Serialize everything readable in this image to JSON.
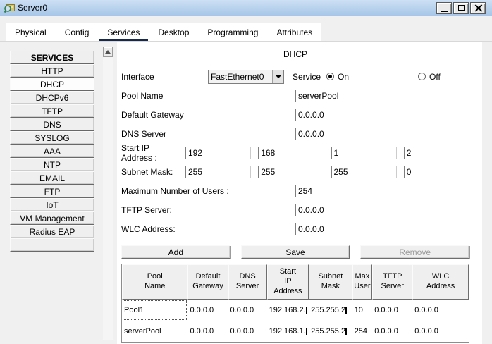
{
  "window": {
    "title": "Server0"
  },
  "tabs": [
    {
      "label": "Physical",
      "selected": false
    },
    {
      "label": "Config",
      "selected": false
    },
    {
      "label": "Services",
      "selected": true
    },
    {
      "label": "Desktop",
      "selected": false
    },
    {
      "label": "Programming",
      "selected": false
    },
    {
      "label": "Attributes",
      "selected": false
    }
  ],
  "sidebar": {
    "header": "SERVICES",
    "items": [
      {
        "label": "HTTP",
        "selected": false
      },
      {
        "label": "DHCP",
        "selected": true
      },
      {
        "label": "DHCPv6",
        "selected": false
      },
      {
        "label": "TFTP",
        "selected": false
      },
      {
        "label": "DNS",
        "selected": false
      },
      {
        "label": "SYSLOG",
        "selected": false
      },
      {
        "label": "AAA",
        "selected": false
      },
      {
        "label": "NTP",
        "selected": false
      },
      {
        "label": "EMAIL",
        "selected": false
      },
      {
        "label": "FTP",
        "selected": false
      },
      {
        "label": "IoT",
        "selected": false
      },
      {
        "label": "VM Management",
        "selected": false
      },
      {
        "label": "Radius EAP",
        "selected": false
      }
    ]
  },
  "dhcp": {
    "panel_title": "DHCP",
    "interface": {
      "label": "Interface",
      "value": "FastEthernet0"
    },
    "service": {
      "label": "Service",
      "on_label": "On",
      "off_label": "Off",
      "state": "On"
    },
    "fields_top": [
      {
        "label": "Pool Name",
        "value": "serverPool"
      },
      {
        "label": "Default Gateway",
        "value": "0.0.0.0"
      },
      {
        "label": "DNS Server",
        "value": "0.0.0.0"
      }
    ],
    "start_ip": {
      "label": "Start IP Address :",
      "octets": [
        "192",
        "168",
        "1",
        "2"
      ]
    },
    "subnet_mask": {
      "label": "Subnet Mask:",
      "octets": [
        "255",
        "255",
        "255",
        "0"
      ]
    },
    "fields_bottom": [
      {
        "label": "Maximum Number of Users :",
        "value": "254"
      },
      {
        "label": "TFTP Server:",
        "value": "0.0.0.0"
      },
      {
        "label": "WLC Address:",
        "value": "0.0.0.0"
      }
    ],
    "actions": [
      {
        "label": "Add",
        "enabled": true
      },
      {
        "label": "Save",
        "enabled": true
      },
      {
        "label": "Remove",
        "enabled": false
      }
    ],
    "table": {
      "headers": [
        "Pool\nName",
        "Default\nGateway",
        "DNS\nServer",
        "Start\nIP\nAddress",
        "Subnet\nMask",
        "Max\nUser",
        "TFTP\nServer",
        "WLC\nAddress"
      ],
      "rows": [
        {
          "cells": [
            "Pool1",
            "0.0.0.0",
            "0.0.0.0",
            "192.168.2.",
            "255.255.2",
            "10",
            "0.0.0.0",
            "0.0.0.0"
          ],
          "selected": true
        },
        {
          "cells": [
            "serverPool",
            "0.0.0.0",
            "0.0.0.0",
            "192.168.1.",
            "255.255.2",
            "254",
            "0.0.0.0",
            "0.0.0.0"
          ],
          "selected": false
        }
      ],
      "clipped_columns": [
        3,
        4
      ]
    }
  },
  "colors": {
    "tab_accent": "#16294d",
    "titlebar": "#b9d2ec"
  }
}
